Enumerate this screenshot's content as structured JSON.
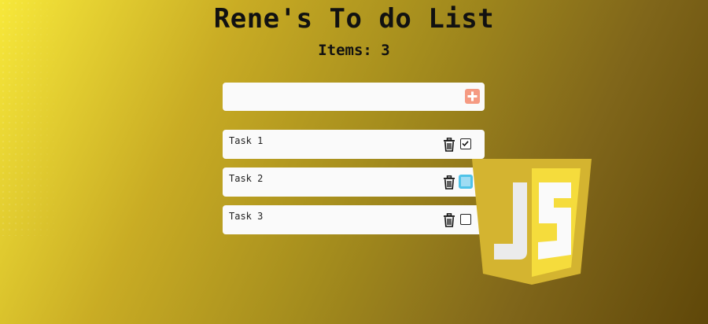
{
  "header": {
    "title": "Rene's To do List",
    "count_label": "Items: 3"
  },
  "new_task": {
    "value": "",
    "placeholder": ""
  },
  "tasks": [
    {
      "label": "Task 1",
      "checked": true
    },
    {
      "label": "Task 2",
      "checked": false
    },
    {
      "label": "Task 3",
      "checked": false
    }
  ],
  "colors": {
    "add_button": "#f59a82",
    "focus_ring": "#4fc3e8",
    "logo_dark": "#d4b430",
    "logo_light": "#f5dc3c",
    "logo_j": "#ebebeb"
  },
  "icons": {
    "add": "plus-square-icon",
    "delete": "trash-icon",
    "done": "checkbox-icon",
    "logo": "javascript-shield-logo"
  }
}
